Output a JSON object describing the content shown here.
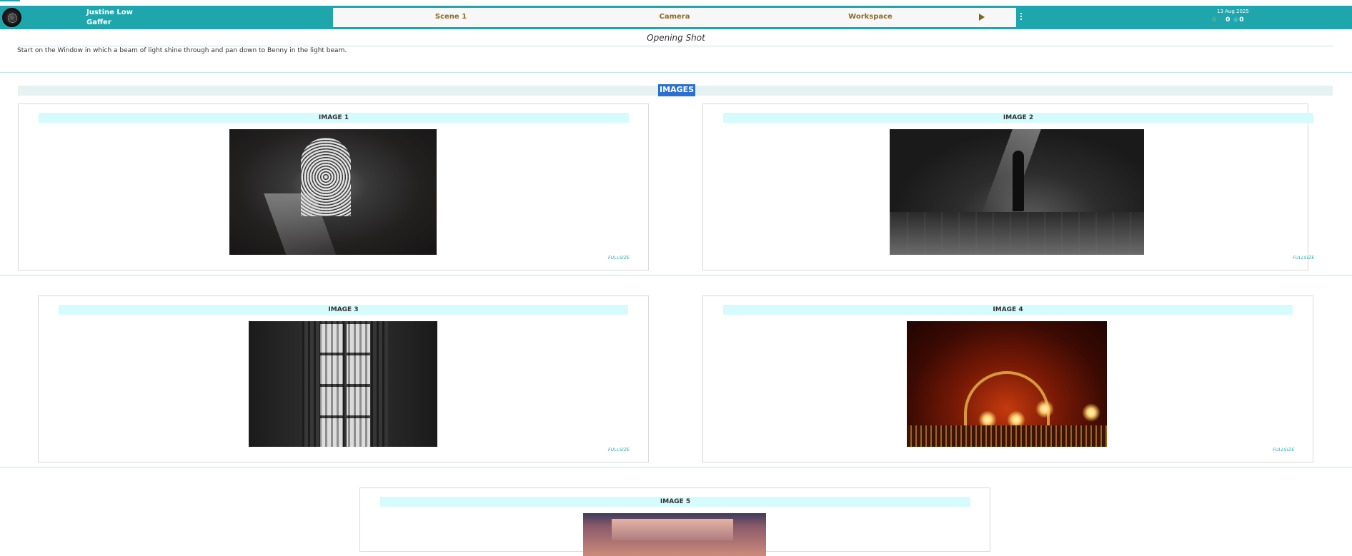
{
  "header": {
    "user_name": "Justine Low",
    "user_role": "Gaffer",
    "nav": [
      "Scene 1",
      "Camera",
      "Workspace"
    ],
    "date": "13 Aug 2025",
    "likes": "0",
    "views": "0",
    "accent_color": "#1fa6ad"
  },
  "shot": {
    "title": "Opening Shot",
    "description": "Start on the Window in which a beam of light shine through and pan down to Benny in the light beam."
  },
  "images_section": {
    "heading": "IMAGES",
    "fullsize_label": "FULLSIZE",
    "cards": [
      {
        "title": "IMAGE 1"
      },
      {
        "title": "IMAGE 2"
      },
      {
        "title": "IMAGE 3"
      },
      {
        "title": "IMAGE 4"
      },
      {
        "title": "IMAGE 5"
      }
    ]
  }
}
